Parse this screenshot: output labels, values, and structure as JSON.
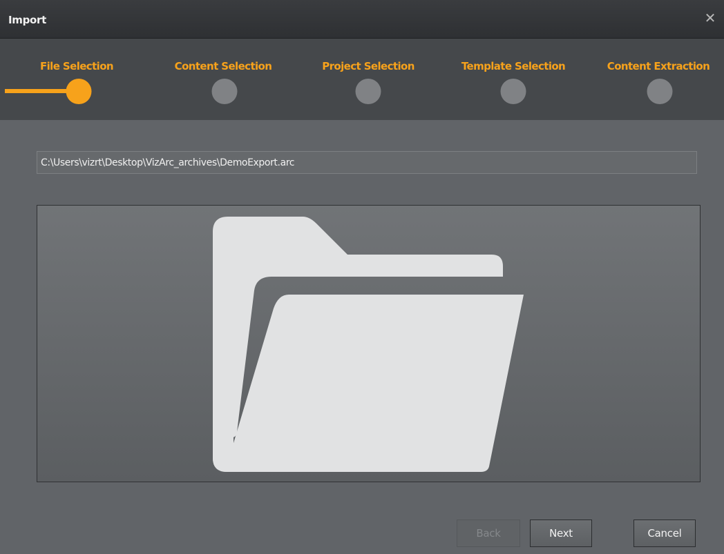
{
  "window": {
    "title": "Import",
    "close_glyph": "✕"
  },
  "steps": [
    {
      "label": "File Selection",
      "active": true
    },
    {
      "label": "Content Selection",
      "active": false
    },
    {
      "label": "Project Selection",
      "active": false
    },
    {
      "label": "Template Selection",
      "active": false
    },
    {
      "label": "Content Extraction",
      "active": false
    }
  ],
  "file_path": "C:\\Users\\vizrt\\Desktop\\VizArc_archives\\DemoExport.arc",
  "drop_area": {
    "icon": "folder-icon"
  },
  "buttons": {
    "back": "Back",
    "next": "Next",
    "cancel": "Cancel"
  },
  "colors": {
    "accent": "#f7a21b",
    "inactive_step": "#808285",
    "folder": "#e1e2e3"
  }
}
